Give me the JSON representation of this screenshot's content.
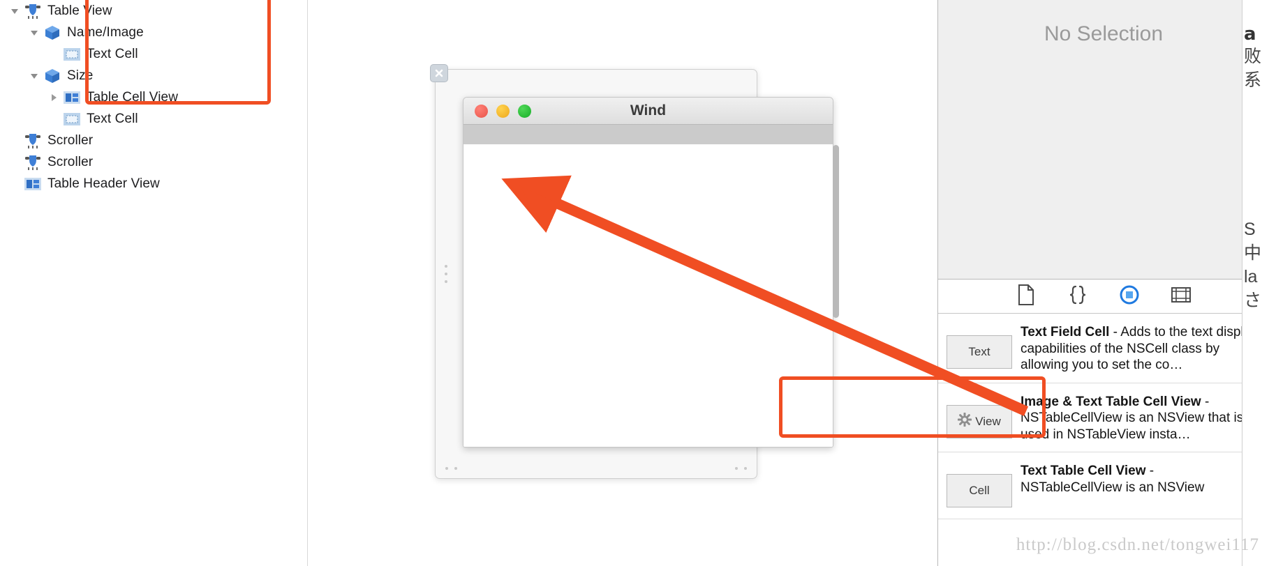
{
  "outline": {
    "rows": [
      {
        "indent": 0,
        "triangle": "down",
        "icon": "table-view-icon",
        "label": "Table View"
      },
      {
        "indent": 1,
        "triangle": "down",
        "icon": "cube-icon",
        "label": "Name/Image"
      },
      {
        "indent": 2,
        "triangle": "none",
        "icon": "text-cell-icon",
        "label": "Text Cell"
      },
      {
        "indent": 1,
        "triangle": "down",
        "icon": "cube-icon",
        "label": "Size"
      },
      {
        "indent": 2,
        "triangle": "right",
        "icon": "table-cell-view-icon",
        "label": "Table Cell View"
      },
      {
        "indent": 2,
        "triangle": "none",
        "icon": "text-cell-icon",
        "label": "Text Cell"
      },
      {
        "indent": 0,
        "triangle": "none",
        "icon": "scroller-icon",
        "label": "Scroller"
      },
      {
        "indent": 0,
        "triangle": "none",
        "icon": "scroller-icon",
        "label": "Scroller"
      },
      {
        "indent": 0,
        "triangle": "none",
        "icon": "table-header-view-icon",
        "label": "Table Header View"
      }
    ]
  },
  "canvas": {
    "window_title": "Wind",
    "close_badge_icon": "close-icon",
    "traffic_lights": [
      "close-light",
      "minimize-light",
      "zoom-light"
    ]
  },
  "inspector": {
    "empty_label": "No Selection"
  },
  "library": {
    "tabs": [
      {
        "name": "file-template-icon",
        "selected": false
      },
      {
        "name": "code-snippet-icon",
        "selected": false
      },
      {
        "name": "objects-icon",
        "selected": true
      },
      {
        "name": "media-icon",
        "selected": false
      }
    ],
    "items": [
      {
        "thumb_label": "Text",
        "thumb_icon": "none",
        "title": "Text Field Cell",
        "dash": " - ",
        "description": "Adds to the text display capabilities of the NSCell class by allowing you to set the co…"
      },
      {
        "thumb_label": "View",
        "thumb_icon": "gear-icon",
        "title": "Image & Text Table Cell View",
        "dash": " - ",
        "description": "NSTableCellView is an NSView that is used in NSTableView insta…"
      },
      {
        "thumb_label": "Cell",
        "thumb_icon": "none",
        "title": "Text Table Cell View",
        "dash": " - ",
        "description": "NSTableCellView is an NSView"
      }
    ]
  },
  "far_right": {
    "fragment_top": "a",
    "fragment_cjk": "败\n系",
    "fragment_bottom": "S\n中\nla\nさ"
  },
  "annotations": {
    "watermark": "http://blog.csdn.net/tongwei117",
    "accent_color": "#f04e23"
  }
}
